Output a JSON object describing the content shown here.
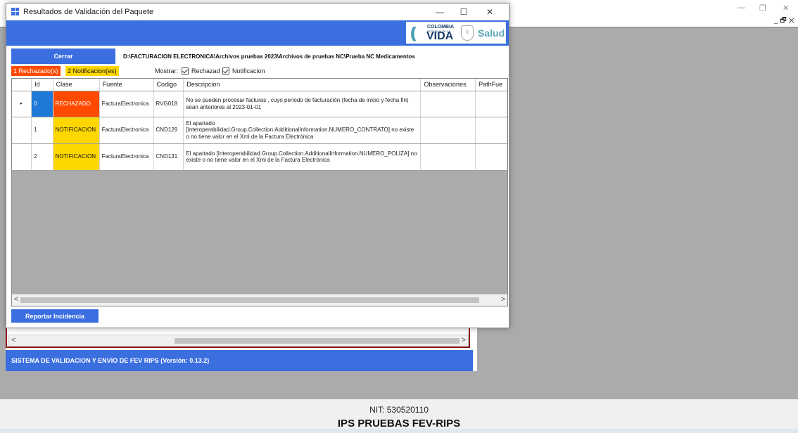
{
  "background": {
    "title_controls": {
      "minimize": "—",
      "restore": "❐",
      "close": "✕",
      "inner": "_ 🗗 ✕"
    },
    "status_bar_text": "SISTEMA DE VALIDACION Y ENVIO DE FEV RIPS  (Versión: 0.13.2)",
    "nit": "NIT: 530520110",
    "ips_name": "IPS PRUEBAS FEV-RIPS",
    "scroll_left": "<",
    "scroll_right": ">"
  },
  "dialog": {
    "title": "Resultados de Validación del Paquete",
    "controls": {
      "minimize": "—",
      "maximize": "☐",
      "close": "✕"
    },
    "logo": {
      "arc": "((",
      "colombia": "COLOMBIA",
      "potencia": "POTENCIA DE LA",
      "vida": "VIDA",
      "shield": "⚕",
      "salud": "Salud"
    },
    "close_button": "Cerrar",
    "path": "D:\\FACTURACION ELECTRONICA\\Archivos pruebas 2023\\Archivos de pruebas NC\\Prueba NC Medicamentos",
    "rejected_badge": "1 Rechazado(s)",
    "notification_badge": "2 Notificacion(es)",
    "show_label": "Mostrar:",
    "filter_rejected": "Rechazad",
    "filter_notification": "Notificacion",
    "report_button": "Reportar Incidencia",
    "scroll_left": "<",
    "scroll_right": ">"
  },
  "grid": {
    "columns": [
      "",
      "Id",
      "Clase",
      "Fuente",
      "Codigo",
      "Descripcion",
      "Observaciones",
      "PathFue"
    ],
    "rows": [
      {
        "marker": "▸",
        "id": "0",
        "clase": "RECHAZADO",
        "fuente": "FacturaElectronica",
        "codigo": "RVG018",
        "descripcion": "No se pueden procesar facturas , cuyo periodo de facturación (fecha de inicio y fecha fin) sean anteriores al 2023-01-01",
        "observaciones": "",
        "path": ""
      },
      {
        "marker": "",
        "id": "1",
        "clase": "NOTIFICACION",
        "fuente": "FacturaElectronica",
        "codigo": "CND129",
        "descripcion": "El apartado [Interoperabilidad.Group.Collection.AdditionalInformation.NUMERO_CONTRATO] no existe o no tiene valor en el Xml de la Factura Electrónica",
        "observaciones": "",
        "path": ""
      },
      {
        "marker": "",
        "id": "2",
        "clase": "NOTIFICACION",
        "fuente": "FacturaElectronica",
        "codigo": "CND131",
        "descripcion": "El apartado [Interoperabilidad.Group.Collection.AdditionalInformation.NUMERO_POLIZA] no existe o no tiene valor en el Xml de la Factura Electrónica",
        "observaciones": "",
        "path": ""
      }
    ]
  },
  "colors": {
    "accent": "#3b6fe0",
    "rejected": "#ff4a00",
    "notification": "#ffd700",
    "selected": "#1e7ad6",
    "frame": "#8b1a1a"
  }
}
